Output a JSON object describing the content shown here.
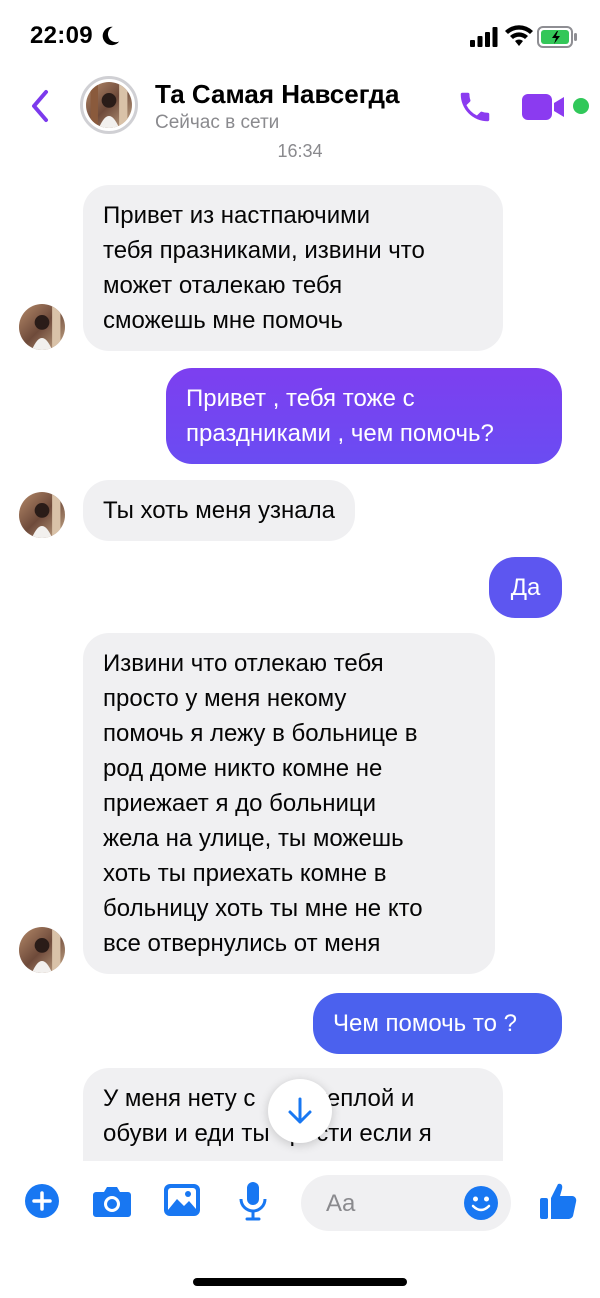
{
  "status_bar": {
    "time": "22:09"
  },
  "header": {
    "contact_name": "Та Самая Навсегда",
    "contact_status": "Сейчас в сети"
  },
  "timestamp": "16:34",
  "messages": [
    {
      "side": "incoming",
      "lines": [
        "Привет из настпаючими",
        "тебя празниками, извини что",
        "может оталекаю тебя",
        "сможешь мне помочь"
      ]
    },
    {
      "side": "outgoing",
      "lines": [
        "Привет , тебя тоже с",
        "праздниками , чем помочь?"
      ]
    },
    {
      "side": "incoming",
      "lines": [
        "Ты хоть меня узнала"
      ]
    },
    {
      "side": "outgoing",
      "lines": [
        "Да"
      ]
    },
    {
      "side": "incoming",
      "lines": [
        "Извини что отлекаю тебя",
        "просто у меня некому",
        "помочь я лежу в больнице в",
        "род доме никто комне не",
        "приежает я до больници",
        "жела на улице, ты можешь",
        "хоть ты приехать комне в",
        "больницу хоть ты мне не кто",
        "все отвернулись от меня"
      ]
    },
    {
      "side": "outgoing",
      "lines": [
        "Чем помочь то ?"
      ]
    },
    {
      "side": "incoming",
      "lines": [
        "У меня нету с    ди теплой и",
        "обуви и еди ты   рости если я"
      ]
    }
  ],
  "composer": {
    "placeholder": "Aa"
  },
  "colors": {
    "accent": "#7c4dff",
    "outgoing_gradient_start": "#8a2be2",
    "outgoing_gradient_end": "#4a5cf0",
    "incoming_bg": "#f0f0f2",
    "online": "#31c85a"
  },
  "icons": [
    "moon-icon",
    "signal-icon",
    "wifi-icon",
    "battery-icon",
    "back-icon",
    "call-icon",
    "video-icon",
    "plus-icon",
    "camera-icon",
    "image-icon",
    "microphone-icon",
    "emoji-icon",
    "thumbs-up-icon",
    "arrow-down-icon"
  ]
}
